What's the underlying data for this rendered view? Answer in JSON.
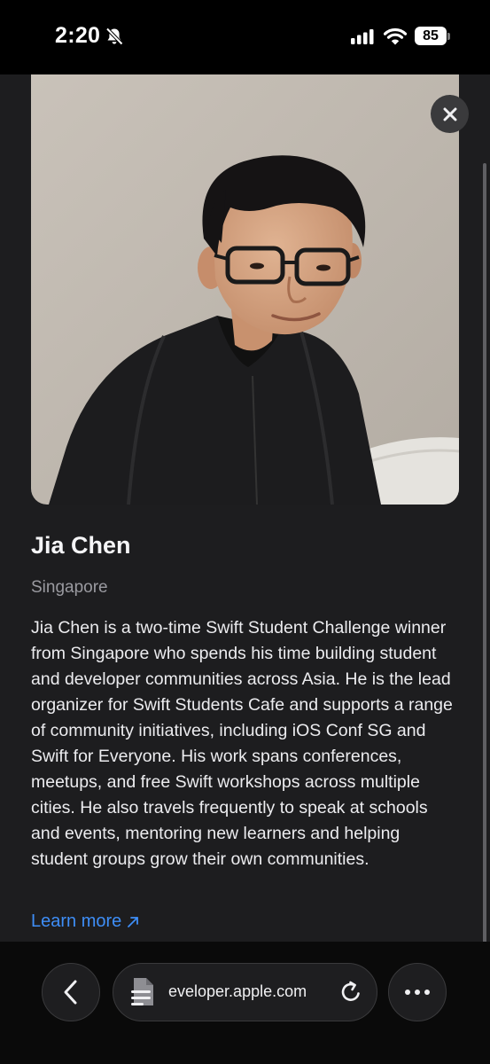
{
  "status_bar": {
    "time": "2:20",
    "battery": "85"
  },
  "profile": {
    "name": "Jia Chen",
    "location": "Singapore",
    "bio": "Jia Chen is a two-time Swift Student Challenge winner from Singapore who spends his time building student and developer communities across Asia. He is the lead organizer for Swift Students Cafe and supports a range of community initiatives, including iOS Conf SG and Swift for Everyone. His work spans conferences, meetups, and free Swift workshops across multiple cities. He also travels frequently to speak at schools and events, mentoring new learners and helping student groups grow their own communities.",
    "learn_more": "Learn more",
    "link_color": "#3e8ef7"
  },
  "browser": {
    "url": "eveloper.apple.com"
  },
  "icons": {
    "close": "close-icon",
    "back": "chevron-left-icon",
    "page": "page-icon",
    "reload": "reload-icon",
    "more": "ellipsis-icon",
    "external": "arrow-up-right-icon"
  }
}
